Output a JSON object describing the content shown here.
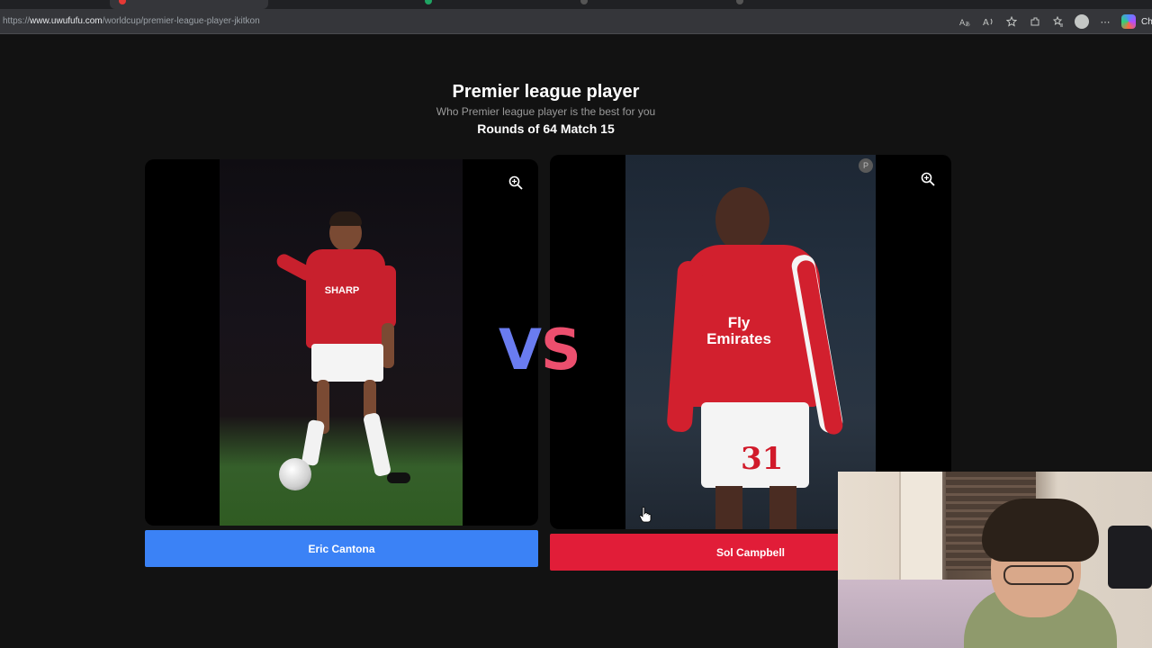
{
  "browser": {
    "url_prefix": "https://",
    "url_domain": "www.uwufufu.com",
    "url_path": "/worldcup/premier-league-player-jkitkon",
    "tab_overflow_text": "Ch",
    "toolbar_icons": [
      "translate-icon",
      "read-aloud-icon",
      "favorite-star-icon",
      "extensions-icon",
      "favorites-icon",
      "profile-avatar-icon",
      "more-menu-icon",
      "copilot-icon"
    ]
  },
  "page": {
    "title": "Premier league player",
    "subtitle": "Who Premier league player is the best for you",
    "round_label": "Rounds of 64 Match 15",
    "vs_v": "V",
    "vs_s": "S"
  },
  "left_candidate": {
    "name": "Eric Cantona",
    "shirt_sponsor": "SHARP",
    "button_color": "#3b82f6"
  },
  "right_candidate": {
    "name": "Sol Campbell",
    "shirt_sponsor_line1": "Fly",
    "shirt_sponsor_line2": "Emirates",
    "shirt_number": "31",
    "button_color": "#e11d38"
  },
  "colors": {
    "background": "#121212",
    "vs_v": "#6a7cf0",
    "vs_s": "#ec4f6e"
  }
}
